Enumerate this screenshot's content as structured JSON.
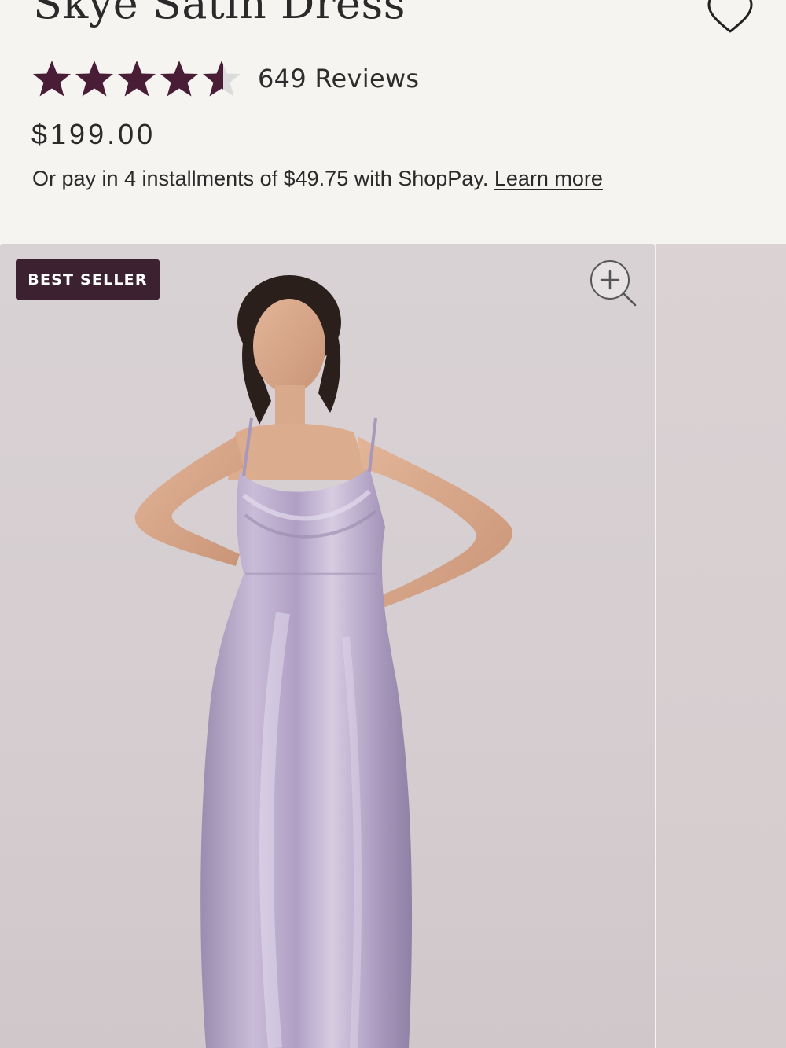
{
  "product": {
    "title": "Skye Satin Dress",
    "rating": 4.5,
    "rating_max": 5,
    "reviews_label": "649 Reviews",
    "price": "$199.00",
    "installments_text": "Or pay in 4 installments of $49.75 with ShopPay.",
    "learn_more_label": "Learn more"
  },
  "gallery": {
    "badge_label": "BEST SELLER"
  },
  "icons": {
    "wishlist": "heart-outline-icon",
    "zoom": "magnifier-plus-icon",
    "star": "star-icon"
  },
  "colors": {
    "star_fill": "#4a1d36",
    "star_empty": "#dcdcdc",
    "badge_bg": "#3c2130",
    "page_bg": "#f5f4f1",
    "dress": "#b4a5c7"
  }
}
